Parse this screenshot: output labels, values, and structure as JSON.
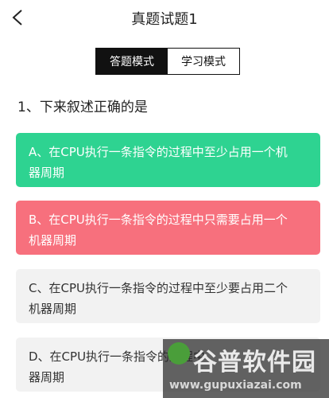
{
  "header": {
    "title": "真题试题1",
    "back_icon": "chevron-left-icon"
  },
  "mode_switch": {
    "tabs": [
      {
        "label": "答题模式",
        "active": true
      },
      {
        "label": "学习模式",
        "active": false
      }
    ]
  },
  "question": {
    "text": "1、下来叙述正确的是"
  },
  "options": [
    {
      "line1": "A、在CPU执行一条指令的过程中至少占用一个机",
      "line2": "器周期",
      "state": "correct"
    },
    {
      "line1": "B、在CPU执行一条指令的过程中只需要占用一个",
      "line2": "机器周期",
      "state": "wrong"
    },
    {
      "line1": "C、在CPU执行一条指令的过程中至少要占用二个",
      "line2": "机器周期",
      "state": "normal"
    },
    {
      "line1": "D、在CPU执行一条指令的过程中",
      "line2": "器周期",
      "state": "normal"
    }
  ],
  "watermark": {
    "main": "谷普软件园",
    "url": "www.gupuxiazai.com"
  },
  "colors": {
    "correct": "#2ed391",
    "wrong": "#f7707d",
    "normal": "#f2f2f2",
    "switch_active": "#111111"
  }
}
